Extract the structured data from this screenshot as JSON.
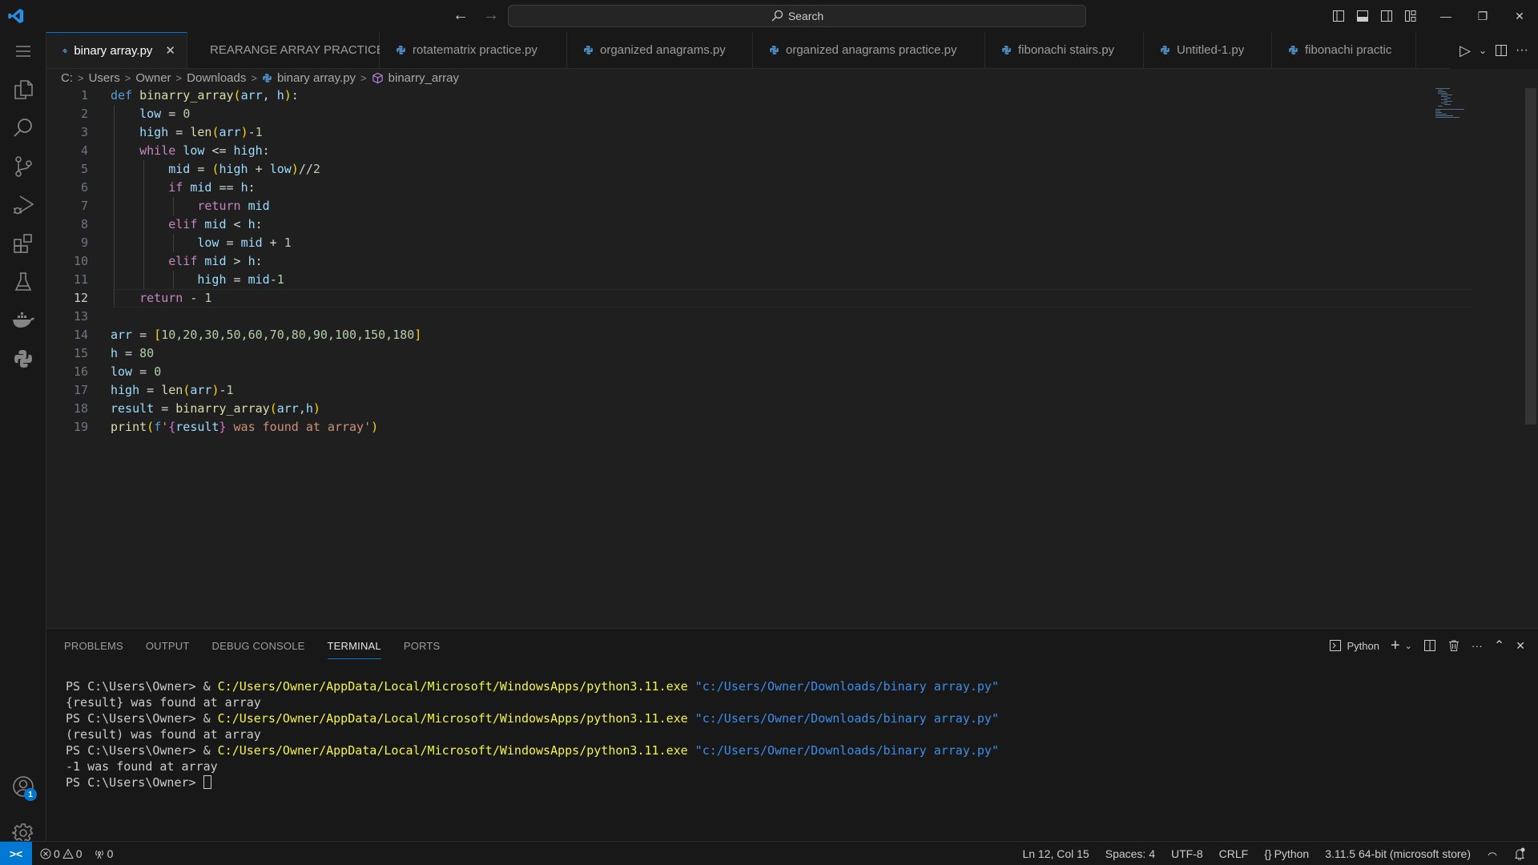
{
  "titlebar": {
    "search_label": "Search",
    "icons": [
      "vscode-logo-icon",
      "back-arrow-icon",
      "forward-arrow-icon",
      "search-icon",
      "toggle-primary-sidebar-icon",
      "toggle-panel-icon",
      "toggle-secondary-sidebar-icon",
      "customize-layout-icon",
      "minimize-icon",
      "restore-icon",
      "close-icon"
    ],
    "back_glyph": "←",
    "forward_glyph": "→",
    "minimize_glyph": "—",
    "restore_glyph": "❐",
    "close_glyph": "✕"
  },
  "activity_bar": {
    "items": [
      "menu",
      "explorer",
      "search",
      "source-control",
      "run-and-debug",
      "extensions",
      "testing",
      "docker",
      "python"
    ],
    "accounts_badge": "1",
    "bottom": [
      "accounts",
      "manage"
    ]
  },
  "tabs": [
    {
      "label": "binary array.py",
      "active": true
    },
    {
      "label": "REARANGE ARRAY PRACTICE.py",
      "active": false
    },
    {
      "label": "rotatematrix practice.py",
      "active": false
    },
    {
      "label": "organized anagrams.py",
      "active": false
    },
    {
      "label": "organized anagrams practice.py",
      "active": false
    },
    {
      "label": "fibonachi stairs.py",
      "active": false
    },
    {
      "label": "Untitled-1.py",
      "active": false
    },
    {
      "label": "fibonachi practic",
      "active": false
    }
  ],
  "tab_close_glyph": "✕",
  "tab_actions": {
    "run_glyph": "▷",
    "dropdown_glyph": "⌄",
    "more_glyph": "···"
  },
  "breadcrumb": [
    "C:",
    "Users",
    "Owner",
    "Downloads",
    "binary array.py",
    "binarry_array"
  ],
  "breadcrumb_sep": ">",
  "editor": {
    "current_line": 12,
    "lines": [
      {
        "n": "1"
      },
      {
        "n": "2"
      },
      {
        "n": "3"
      },
      {
        "n": "4"
      },
      {
        "n": "5"
      },
      {
        "n": "6"
      },
      {
        "n": "7"
      },
      {
        "n": "8"
      },
      {
        "n": "9"
      },
      {
        "n": "10"
      },
      {
        "n": "11"
      },
      {
        "n": "12"
      },
      {
        "n": "13"
      },
      {
        "n": "14"
      },
      {
        "n": "15"
      },
      {
        "n": "16"
      },
      {
        "n": "17"
      },
      {
        "n": "18"
      },
      {
        "n": "19"
      }
    ],
    "code": {
      "l1": {
        "def": "def ",
        "fn": "binarry_array",
        "p1": "(",
        "a": "arr",
        "c": ", ",
        "h": "h",
        "p2": ")",
        "colon": ":"
      },
      "l2": {
        "v": "low",
        "eq": " = ",
        "n": "0"
      },
      "l3": {
        "v": "high",
        "eq": " = ",
        "fn": "len",
        "p1": "(",
        "a": "arr",
        "p2": ")",
        "rest": "-",
        "n": "1"
      },
      "l4": {
        "kw": "while ",
        "v1": "low",
        "op": " <= ",
        "v2": "high",
        "colon": ":"
      },
      "l5": {
        "v": "mid",
        "eq": " = ",
        "p1": "(",
        "v1": "high",
        "op": " + ",
        "v2": "low",
        "p2": ")",
        "rest": "//",
        "n": "2"
      },
      "l6": {
        "kw": "if ",
        "v": "mid",
        "op": " == ",
        "h": "h",
        "colon": ":"
      },
      "l7": {
        "kw": "return ",
        "v": "mid"
      },
      "l8": {
        "kw": "elif ",
        "v": "mid",
        "op": " < ",
        "h": "h",
        "colon": ":"
      },
      "l9": {
        "v": "low",
        "eq": " = ",
        "v2": "mid",
        "op": " + ",
        "n": "1"
      },
      "l10": {
        "kw": "elif ",
        "v": "mid",
        "op": " > ",
        "h": "h",
        "colon": ":"
      },
      "l11": {
        "v": "high",
        "eq": " = ",
        "v2": "mid",
        "op": "-",
        "n": "1"
      },
      "l12": {
        "kw": "return ",
        "op": "- ",
        "n": "1"
      },
      "l14": {
        "v": "arr",
        "eq": " = ",
        "b1": "[",
        "vals": "10,20,30,50,60,70,80,90,100,150,180",
        "b2": "]"
      },
      "l15": {
        "v": "h",
        "eq": " = ",
        "n": "80"
      },
      "l16": {
        "v": "low",
        "eq": " = ",
        "n": "0"
      },
      "l17": {
        "v": "high",
        "eq": " = ",
        "fn": "len",
        "p1": "(",
        "a": "arr",
        "p2": ")",
        "rest": "-",
        "n": "1"
      },
      "l18": {
        "v": "result",
        "eq": " = ",
        "fn": "binarry_array",
        "p1": "(",
        "a": "arr",
        "c": ",",
        "h": "h",
        "p2": ")"
      },
      "l19": {
        "fn": "print",
        "p1": "(",
        "f": "f",
        "q1": "'",
        "b1": "{",
        "v": "result",
        "b2": "}",
        "s": " was found at array",
        "q2": "'",
        "p2": ")"
      }
    }
  },
  "panel": {
    "tabs": [
      {
        "label": "PROBLEMS",
        "active": false
      },
      {
        "label": "OUTPUT",
        "active": false
      },
      {
        "label": "DEBUG CONSOLE",
        "active": false
      },
      {
        "label": "TERMINAL",
        "active": true
      },
      {
        "label": "PORTS",
        "active": false
      }
    ],
    "terminal_name": "Python",
    "actions_glyphs": {
      "new": "+",
      "dropdown": "⌄",
      "more": "···",
      "maximize": "⌃",
      "close": "✕"
    },
    "terminal": {
      "prompt": "PS C:\\Users\\Owner> ",
      "amp": "& ",
      "exe": "C:/Users/Owner/AppData/Local/Microsoft/WindowsApps/python3.11.exe",
      "script": " \"c:/Users/Owner/Downloads/binary array.py\"",
      "outputs": [
        "{result} was found at array",
        "(result) was found at array",
        "-1 was found at array"
      ]
    }
  },
  "statusbar": {
    "remote_glyph": "><",
    "errors": "0",
    "warnings": "0",
    "ports": "0",
    "position": "Ln 12, Col 15",
    "spaces": "Spaces: 4",
    "encoding": "UTF-8",
    "eol": "CRLF",
    "language": "Python",
    "interpreter": "3.11.5 64-bit (microsoft store)"
  },
  "colors": {
    "accent": "#0078d4",
    "keyword": "#c586c0",
    "function": "#dcdcaa",
    "variable": "#9cdcfe",
    "number": "#b5cea8",
    "string": "#ce9178"
  }
}
